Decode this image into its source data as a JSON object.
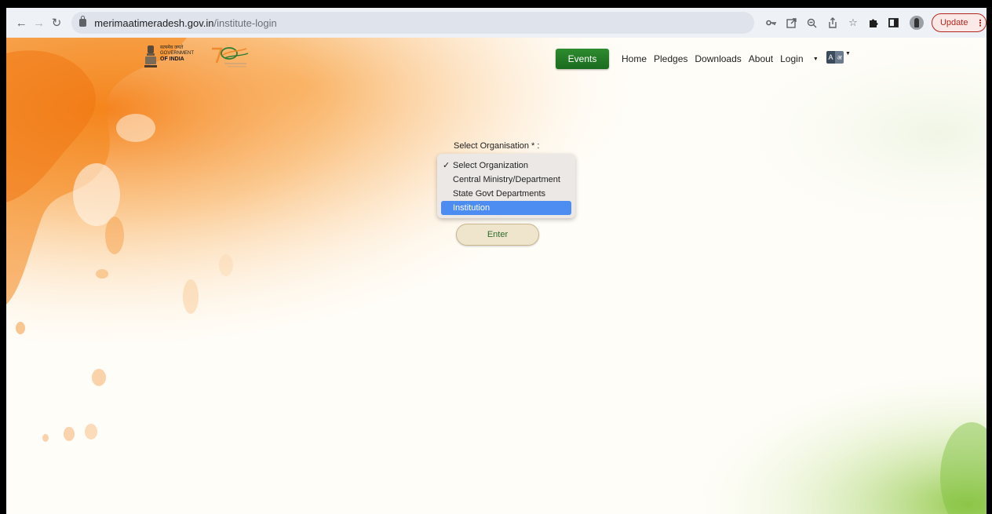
{
  "browser": {
    "url_host": "merimaatimeradesh.gov.in",
    "url_path": "/institute-login",
    "update_label": "Update",
    "update_dots": "⋮"
  },
  "header": {
    "logo_line1": "सत्यमेव जयते",
    "logo_line2": "GOVERNMENT",
    "logo_line3": "OF INDIA",
    "events_label": "Events",
    "nav": {
      "home": "Home",
      "pledges": "Pledges",
      "downloads": "Downloads",
      "about": "About",
      "login": "Login"
    },
    "lang_a": "A",
    "lang_b": "अ"
  },
  "form": {
    "label": "Select Organisation * :",
    "options": [
      "Select Organization",
      "Central Ministry/Department",
      "State Govt Departments",
      "Institution"
    ],
    "checked_option": "Select Organization",
    "highlighted_option": "Institution",
    "enter_label": "Enter"
  },
  "colors": {
    "saffron": "#f58a1f",
    "green": "#1a6b1f",
    "highlight": "#4d8cf0",
    "update_red": "#b3261e"
  }
}
